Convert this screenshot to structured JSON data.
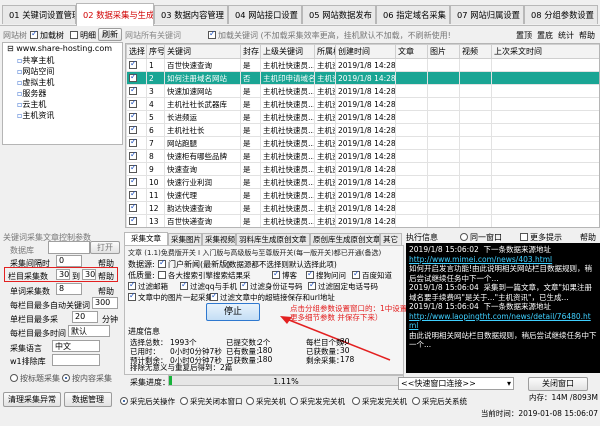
{
  "tabs": [
    {
      "label": "01 关键词设置管理"
    },
    {
      "label": "02 数据采集与生成"
    },
    {
      "label": "03 数据内容管理"
    },
    {
      "label": "04 网站接口设置"
    },
    {
      "label": "05 网站数据发布"
    },
    {
      "label": "06 指定域名采集"
    },
    {
      "label": "07 网站归属设置"
    },
    {
      "label": "08 分组参数设置"
    }
  ],
  "left": {
    "site_list_label": "网站树",
    "load_tree": "加载树",
    "expand": "明细",
    "refresh": "刷新",
    "url": "www.share-hosting.com",
    "tree": [
      "共享主机",
      "网站空间",
      "虚拟主机",
      "服务器",
      "云主机",
      "主机资讯"
    ]
  },
  "top_bar": {
    "all_keywords": "网站所有关键词",
    "load_keywords": "加载关键词 (不加载采集效率更高，挂机默认不加载，不刷新使用!)",
    "top": "置顶",
    "bottom": "置底",
    "stats": "统计",
    "help": "帮助"
  },
  "grid": {
    "columns": [
      "选择",
      "序号",
      "关键词",
      "封存",
      "上级关键词",
      "所属栏目",
      "创建时间",
      "文章",
      "图片",
      "视频",
      "上次采文时间"
    ],
    "rows": [
      [
        "1",
        "百世快速查询",
        "是",
        "主机社快速员…",
        "主机资讯",
        "2019/1/8 14:28"
      ],
      [
        "2",
        "如何注册域名网站",
        "否",
        "主机印申请域名",
        "主机资讯",
        "2019/1/8 14:28"
      ],
      [
        "3",
        "快速加速网站",
        "是",
        "主机社快速员…",
        "主机资讯",
        "2019/1/8 14:28"
      ],
      [
        "4",
        "主机社社长武器库",
        "是",
        "主机社快速员…",
        "主机资讯",
        "2019/1/8 14:28"
      ],
      [
        "5",
        "长进频运",
        "是",
        "主机社快速员…",
        "主机资讯",
        "2019/1/8 14:28"
      ],
      [
        "6",
        "主机社社长",
        "是",
        "主机社快速员…",
        "主机资讯",
        "2019/1/8 14:28"
      ],
      [
        "7",
        "网站跑腿",
        "是",
        "主机社快速员…",
        "主机资讯",
        "2019/1/8 14:28"
      ],
      [
        "8",
        "快速柜有哪些品牌",
        "是",
        "主机社快速员…",
        "主机资讯",
        "2019/1/8 14:28"
      ],
      [
        "9",
        "快速查询",
        "是",
        "主机社快速员…",
        "主机资讯",
        "2019/1/8 14:28"
      ],
      [
        "10",
        "快速行业利润",
        "是",
        "主机社快速员…",
        "主机资讯",
        "2019/1/8 14:28"
      ],
      [
        "11",
        "快速代理",
        "是",
        "主机社快速员…",
        "主机资讯",
        "2019/1/8 14:28"
      ],
      [
        "12",
        "韵达快速查询",
        "是",
        "主机社快速员…",
        "主机资讯",
        "2019/1/8 14:28"
      ],
      [
        "13",
        "百世快递查询",
        "是",
        "主机社快速员…",
        "主机资讯",
        "2019/1/8 14:28"
      ]
    ]
  },
  "params": {
    "group_title": "关键词采集文章控制参数",
    "keyword_count_label": "数据库",
    "open": "打开",
    "interval_label": "采集间隔时",
    "interval_value": "0",
    "help": "帮助",
    "per_column_label": "栏目采集数",
    "per_column_from": "30",
    "to": "到",
    "per_column_to": "30",
    "article_count_label": "单词采集数",
    "article_count_value": "8",
    "per_column_articles": "每栏目最多自动关键词",
    "per_column_articles_value": "300",
    "min_label": "单栏目最多采",
    "min_value": "20",
    "min_unit": "分钟",
    "first_time_label": "每栏目最多时间",
    "first_time_value": "默认",
    "lang_label": "采集语言",
    "lang_value": "中文",
    "w1_label": "w1排除库",
    "radio_chars": "按标题采集",
    "radio_content": "按内容采集"
  },
  "subtabs": [
    "采集文章",
    "采集图片",
    "采集视频",
    "羽料库生成原创文章",
    "原创库生成原创文章",
    "其它"
  ],
  "article_opts": {
    "text1": "文章 (1.1)免费版开关 I 入门版与高级版与至尊版开关(每一版开关)都已开通(备选)",
    "source_label": "数据源:",
    "source_main": "门户新闻(最新版)",
    "source_sub": "(数据源都不选择则默认选择此项)",
    "low_label": "低质量:",
    "low_opts": [
      "各大搜索引擎搜索结果采",
      "博客",
      "搜狗问问",
      "百度知道"
    ],
    "filter_opts": [
      "过滤邮箱",
      "过滤qq与手机",
      "过滤身份证号码",
      "过滤固定电话号码"
    ],
    "extra_opts": [
      "文章中的图片一起采集",
      "过滤文章中的超链接保存和url地址"
    ]
  },
  "stop_btn": "停止",
  "annotation": "点击分组参数设置窗口的：1中设置更多细节参数 并保存下来）",
  "progress": {
    "title": "进度信息",
    "items": [
      [
        "选择总数：",
        "1993个",
        "已提交数：",
        "2个",
        "每栏目个数：",
        "30"
      ],
      [
        "已用时：",
        "0小时0分钟7秒",
        "已有数量：",
        "180",
        "已获数量：",
        "30"
      ],
      [
        "预计剩余：",
        "0小时0分钟7秒",
        "已获数量：",
        "180",
        "剩余采集：",
        "178"
      ]
    ],
    "note": "排除无意义与重复后得到：",
    "note_value": "2篇",
    "bar_label": "采集进度：",
    "percent": "1.11%",
    "fraction": 0.0111
  },
  "log": {
    "title": "执行信息",
    "time_label": "同一窗口",
    "more": "更多提示",
    "help": "帮助",
    "lines": [
      {
        "t": "2019/1/8 15:06:02  下一条数据来源地址",
        "c": ""
      },
      {
        "t": "http://www.mimei.com/news/403.html",
        "c": "blue"
      },
      {
        "t": "如何开启发言功能!由此说明相关网站栏目数据规则，稍后尝试继续任务中下一个...",
        "c": ""
      },
      {
        "t": "2019/1/8 15:06:04  采集到一篇文章，文章\"如果注册域名要手续费吗\"是关于...\"主机资讯\"，已生成...",
        "c": ""
      },
      {
        "t": "2019/1/8 15:06:04  下一条数据来源地址",
        "c": ""
      },
      {
        "t": "http://www.laopingtht.com/news/detail/76480.html",
        "c": "blue"
      },
      {
        "t": "由此说明相关网站栏目数据规则，稍后尝试继续任务中下一个...",
        "c": ""
      }
    ],
    "connect_label": "<<快速窗口连接>>",
    "close_btn": "关闭窗口"
  },
  "bottom": {
    "clean_btn": "清理采集异常",
    "backup_btn": "数据管理",
    "radios": [
      "采完后关操作",
      "采完关闭本窗口",
      "采完关机",
      "采完发完关机",
      "采完发完关机",
      "采完后关系统"
    ],
    "time": "当前时间：2019-01-08 15:06:07",
    "memory": "内存：14M /8093M"
  }
}
